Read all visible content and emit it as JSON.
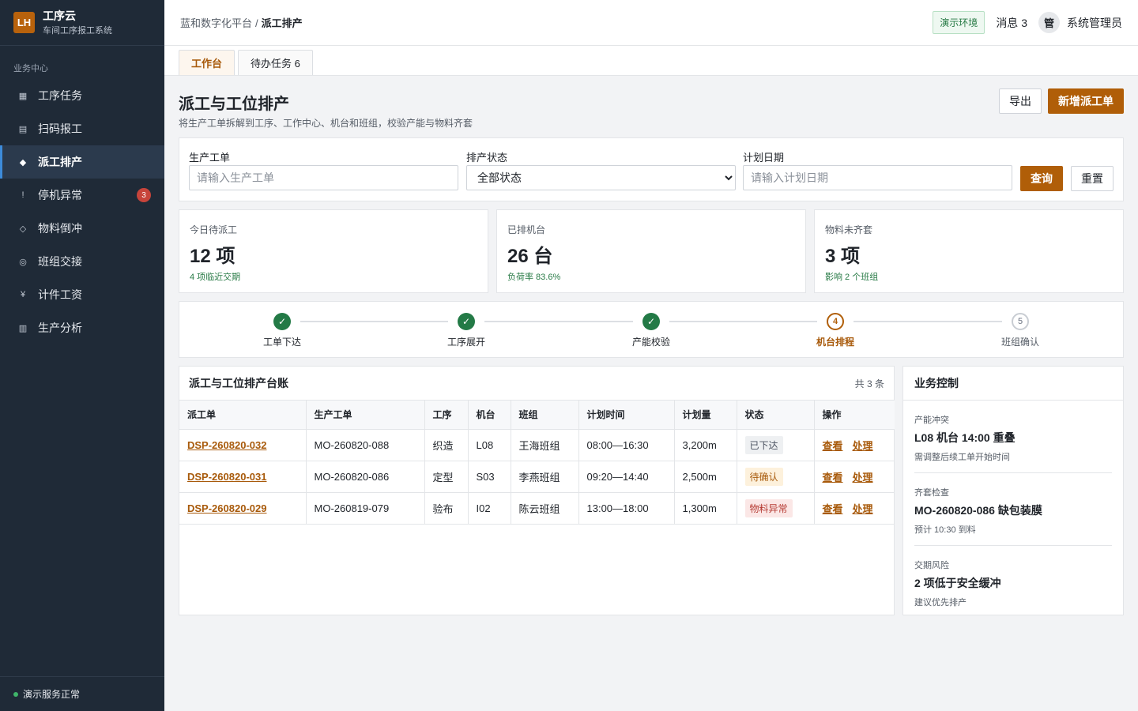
{
  "brand": {
    "logo": "LH",
    "name": "工序云",
    "subtitle": "车间工序报工系统"
  },
  "sidebar": {
    "section": "业务中心",
    "items": [
      {
        "label": "工序任务",
        "icon": "grid-icon",
        "glyph": "▦"
      },
      {
        "label": "扫码报工",
        "icon": "list-icon",
        "glyph": "▤"
      },
      {
        "label": "派工排产",
        "icon": "diamond-icon",
        "glyph": "◆",
        "active": true
      },
      {
        "label": "停机异常",
        "icon": "alert-icon",
        "glyph": "!",
        "badge": "3"
      },
      {
        "label": "物料倒冲",
        "icon": "diamond-outline-icon",
        "glyph": "◇"
      },
      {
        "label": "班组交接",
        "icon": "target-icon",
        "glyph": "◎"
      },
      {
        "label": "计件工资",
        "icon": "yen-icon",
        "glyph": "¥"
      },
      {
        "label": "生产分析",
        "icon": "chart-icon",
        "glyph": "▥"
      }
    ],
    "footer": "演示服务正常"
  },
  "header": {
    "breadcrumb_root": "蓝和数字化平台",
    "breadcrumb_sep": "/",
    "breadcrumb_current": "派工排产",
    "env_tag": "演示环境",
    "messages": "消息 3",
    "avatar": "管",
    "user": "系统管理员"
  },
  "tabs": [
    {
      "label": "工作台",
      "active": true
    },
    {
      "label": "待办任务 6"
    }
  ],
  "page": {
    "title": "派工与工位排产",
    "desc": "将生产工单拆解到工序、工作中心、机台和班组，校验产能与物料齐套",
    "export_label": "导出",
    "new_label": "新增派工单"
  },
  "filter": {
    "order_label": "生产工单",
    "order_placeholder": "请输入生产工单",
    "status_label": "排产状态",
    "status_value": "全部状态",
    "date_label": "计划日期",
    "date_placeholder": "请输入计划日期",
    "query_label": "查询",
    "reset_label": "重置"
  },
  "stats": [
    {
      "label": "今日待派工",
      "value": "12 项",
      "note": "4 项临近交期"
    },
    {
      "label": "已排机台",
      "value": "26 台",
      "note": "负荷率 83.6%"
    },
    {
      "label": "物料未齐套",
      "value": "3 项",
      "note": "影响 2 个班组"
    }
  ],
  "steps": [
    {
      "label": "工单下达",
      "state": "done",
      "mark": "✓"
    },
    {
      "label": "工序展开",
      "state": "done",
      "mark": "✓"
    },
    {
      "label": "产能校验",
      "state": "done",
      "mark": "✓"
    },
    {
      "label": "机台排程",
      "state": "current",
      "mark": "4"
    },
    {
      "label": "班组确认",
      "state": "todo",
      "mark": "5"
    }
  ],
  "ledger": {
    "title": "派工与工位排产台账",
    "count": "共 3 条",
    "columns": [
      "派工单",
      "生产工单",
      "工序",
      "机台",
      "班组",
      "计划时间",
      "计划量",
      "状态",
      "操作"
    ],
    "view_label": "查看",
    "handle_label": "处理",
    "rows": [
      {
        "id": "DSP-260820-032",
        "order": "MO-260820-088",
        "process": "织造",
        "machine": "L08",
        "team": "王海班组",
        "time": "08:00—16:30",
        "qty": "3,200m",
        "status": "已下达",
        "status_kind": "gray"
      },
      {
        "id": "DSP-260820-031",
        "order": "MO-260820-086",
        "process": "定型",
        "machine": "S03",
        "team": "李燕班组",
        "time": "09:20—14:40",
        "qty": "2,500m",
        "status": "待确认",
        "status_kind": "orange"
      },
      {
        "id": "DSP-260820-029",
        "order": "MO-260819-079",
        "process": "验布",
        "machine": "I02",
        "team": "陈云班组",
        "time": "13:00—18:00",
        "qty": "1,300m",
        "status": "物料异常",
        "status_kind": "red"
      }
    ]
  },
  "control": {
    "title": "业务控制",
    "items": [
      {
        "kicker": "产能冲突",
        "title": "L08 机台 14:00 重叠",
        "note": "需调整后续工单开始时间"
      },
      {
        "kicker": "齐套检查",
        "title": "MO-260820-086 缺包装膜",
        "note": "预计 10:30 到料"
      },
      {
        "kicker": "交期风险",
        "title": "2 项低于安全缓冲",
        "note": "建议优先排产"
      }
    ]
  }
}
